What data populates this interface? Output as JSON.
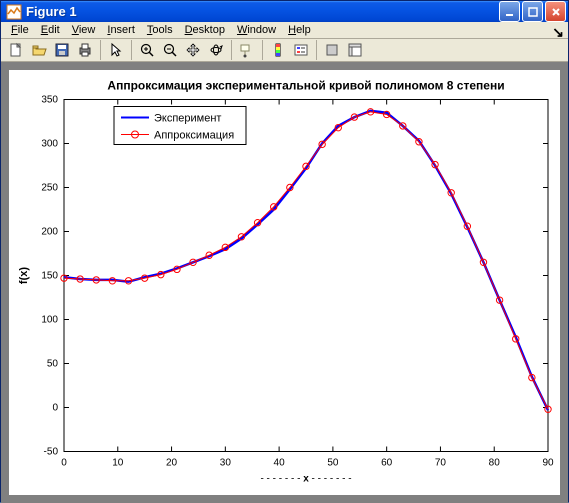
{
  "window": {
    "title": "Figure 1"
  },
  "menu": {
    "file": "File",
    "edit": "Edit",
    "view": "View",
    "insert": "Insert",
    "tools": "Tools",
    "desktop": "Desktop",
    "window": "Window",
    "help": "Help"
  },
  "chart_data": {
    "type": "line",
    "title": "Аппроксимация экспериментальной кривой полиномом 8 степени",
    "xlabel": "x",
    "ylabel": "f(x)",
    "xlim": [
      0,
      90
    ],
    "ylim": [
      -50,
      350
    ],
    "xticks": [
      0,
      10,
      20,
      30,
      40,
      50,
      60,
      70,
      80,
      90
    ],
    "yticks": [
      -50,
      0,
      50,
      100,
      150,
      200,
      250,
      300,
      350
    ],
    "legend": {
      "experiment": "Эксперимент",
      "approx": "Аппроксимация"
    },
    "series": [
      {
        "name": "Эксперимент",
        "color": "#0000ff",
        "style": "line",
        "x": [
          0,
          3,
          6,
          9,
          12,
          15,
          18,
          21,
          24,
          27,
          30,
          33,
          36,
          39,
          42,
          45,
          48,
          51,
          54,
          57,
          60,
          63,
          66,
          69,
          72,
          75,
          78,
          81,
          84,
          87,
          90
        ],
        "y": [
          148,
          146,
          145,
          145,
          143,
          148,
          152,
          158,
          165,
          172,
          180,
          192,
          208,
          225,
          248,
          272,
          300,
          320,
          330,
          337,
          335,
          320,
          303,
          275,
          243,
          205,
          165,
          122,
          80,
          35,
          -3
        ]
      },
      {
        "name": "Аппроксимация",
        "color": "#ff0000",
        "style": "circle-line",
        "x": [
          0,
          3,
          6,
          9,
          12,
          15,
          18,
          21,
          24,
          27,
          30,
          33,
          36,
          39,
          42,
          45,
          48,
          51,
          54,
          57,
          60,
          63,
          66,
          69,
          72,
          75,
          78,
          81,
          84,
          87,
          90
        ],
        "y": [
          147,
          146,
          145,
          144,
          144,
          147,
          151,
          157,
          165,
          173,
          182,
          194,
          210,
          228,
          250,
          274,
          299,
          318,
          330,
          336,
          333,
          320,
          302,
          276,
          244,
          206,
          165,
          122,
          78,
          34,
          -2
        ]
      }
    ]
  }
}
